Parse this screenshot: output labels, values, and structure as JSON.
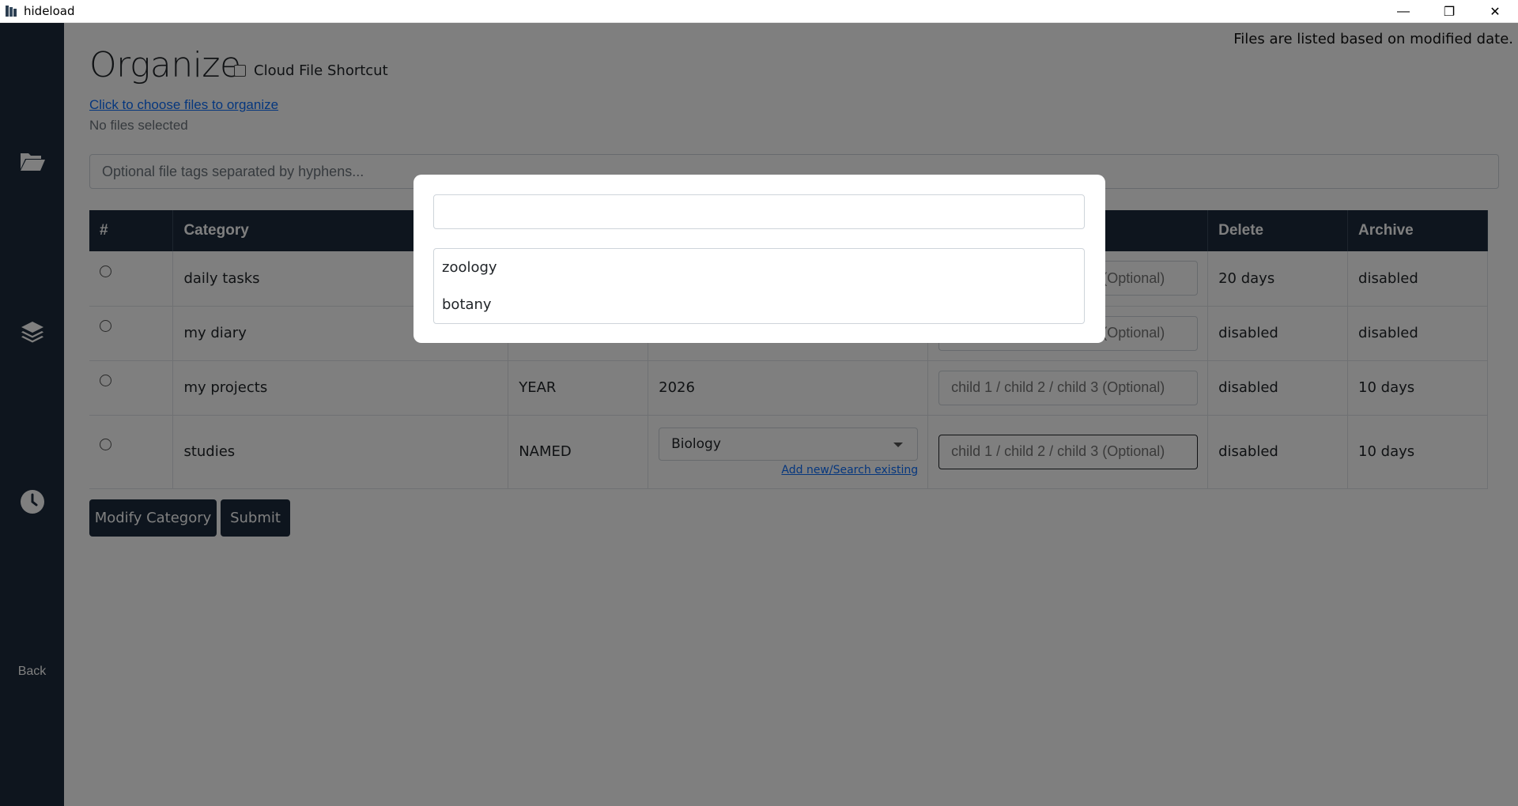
{
  "window": {
    "title": "hideload",
    "minimize_glyph": "—",
    "restore_glyph": "❐",
    "close_glyph": "✕"
  },
  "sidebar": {
    "items": [
      {
        "icon": "folder-open-icon"
      },
      {
        "icon": "layers-icon"
      },
      {
        "icon": "clock-icon"
      }
    ],
    "back_label": "Back"
  },
  "page": {
    "title": "Organize",
    "cloud_shortcut_label": "Cloud File Shortcut",
    "modified_note": "Files are listed based on modified date.",
    "choose_files_link": "Click to choose files to organize",
    "no_files": "No files selected",
    "tags_placeholder": "Optional file tags separated by hyphens..."
  },
  "table": {
    "headers": [
      "#",
      "Category",
      "",
      "",
      "",
      "Delete",
      "Archive"
    ],
    "rows": [
      {
        "category": "daily tasks",
        "type": "",
        "value": "",
        "delete": "20 days",
        "archive": "disabled"
      },
      {
        "category": "my diary",
        "type": "",
        "value": "",
        "delete": "disabled",
        "archive": "disabled"
      },
      {
        "category": "my projects",
        "type": "YEAR",
        "value": "2026",
        "delete": "disabled",
        "archive": "10 days"
      },
      {
        "category": "studies",
        "type": "NAMED",
        "value": "Biology",
        "delete": "disabled",
        "archive": "10 days"
      }
    ],
    "child_placeholder": "child 1 / child 2 / child 3 (Optional)",
    "add_new_link": "Add new/Search existing"
  },
  "buttons": {
    "modify": "Modify Category",
    "submit": "Submit"
  },
  "modal": {
    "search_value": "",
    "options": [
      "zoology",
      "botany"
    ]
  },
  "colors": {
    "sidebar": "#1c2b3d",
    "header": "#1c2b3d",
    "link": "#0d6efd",
    "overlay": "rgba(0,0,0,0.5)"
  }
}
